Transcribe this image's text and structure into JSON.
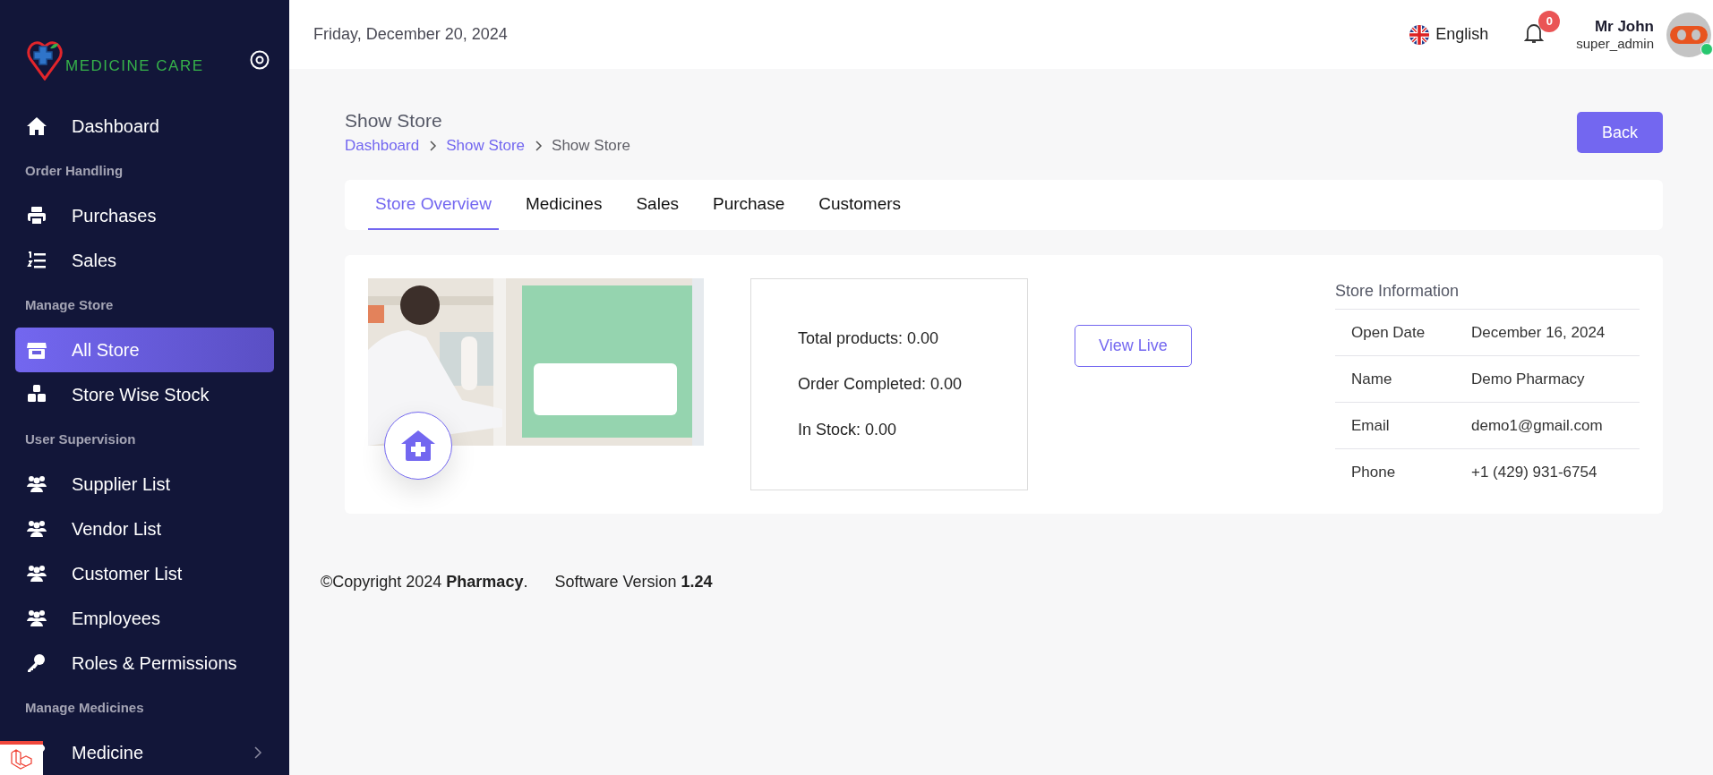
{
  "sidebar": {
    "brand": "MEDICINE CARE",
    "entries": [
      {
        "kind": "link",
        "label": "Dashboard",
        "selected": false
      },
      {
        "kind": "heading",
        "label": "Order Handling"
      },
      {
        "kind": "link",
        "label": "Purchases",
        "selected": false
      },
      {
        "kind": "link",
        "label": "Sales",
        "selected": false
      },
      {
        "kind": "heading",
        "label": "Manage Store"
      },
      {
        "kind": "link",
        "label": "All Store",
        "selected": true
      },
      {
        "kind": "link",
        "label": "Store Wise Stock",
        "selected": false
      },
      {
        "kind": "heading",
        "label": "User Supervision"
      },
      {
        "kind": "link",
        "label": "Supplier List",
        "selected": false
      },
      {
        "kind": "link",
        "label": "Vendor List",
        "selected": false
      },
      {
        "kind": "link",
        "label": "Customer List",
        "selected": false
      },
      {
        "kind": "link",
        "label": "Employees",
        "selected": false
      },
      {
        "kind": "link",
        "label": "Roles & Permissions",
        "selected": false
      },
      {
        "kind": "heading",
        "label": "Manage Medicines"
      },
      {
        "kind": "link",
        "label": "Medicine",
        "selected": false,
        "expanded": false
      }
    ]
  },
  "header": {
    "date": "Friday, December 20, 2024",
    "language": "English",
    "notifications": "0",
    "user": {
      "name": "Mr John",
      "role": "super_admin",
      "online": true
    }
  },
  "page": {
    "title": "Show Store",
    "breadcrumb": [
      {
        "label": "Dashboard",
        "link": true
      },
      {
        "label": "Show Store",
        "link": true
      },
      {
        "label": "Show Store",
        "link": false
      }
    ],
    "back_button": "Back"
  },
  "tabs": [
    {
      "label": "Store Overview",
      "selected": true
    },
    {
      "label": "Medicines",
      "selected": false
    },
    {
      "label": "Sales",
      "selected": false
    },
    {
      "label": "Purchase",
      "selected": false
    },
    {
      "label": "Customers",
      "selected": false
    }
  ],
  "overview": {
    "image": {
      "kind": "picture"
    },
    "stats": [
      "Total products: 0.00",
      "Order Completed: 0.00",
      "In Stock: 0.00"
    ],
    "view_live_button": "View Live",
    "store_information": {
      "title": "Store Information",
      "rows": [
        {
          "label": "Open Date",
          "value": "December 16, 2024"
        },
        {
          "label": "Name",
          "value": "Demo Pharmacy"
        },
        {
          "label": "Email",
          "value": "demo1@gmail.com"
        },
        {
          "label": "Phone",
          "value": "+1 (429) 931-6754"
        }
      ]
    }
  },
  "footer": {
    "copyright": "©Copyright 2024 **Pharmacy**.",
    "version": "Software Version **1.24**"
  }
}
